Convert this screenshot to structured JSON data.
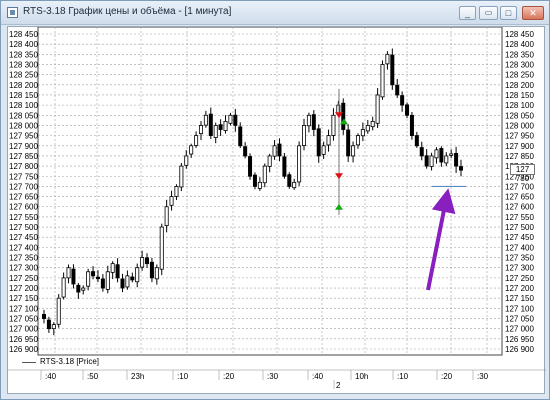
{
  "window": {
    "title": "RTS-3.18 График цены и объёма - [1 минута]",
    "buttons": {
      "minimize": "_",
      "restore": "▭",
      "close": "✕"
    }
  },
  "chart": {
    "price_badge": "127 780",
    "legend_label": "RTS-3.18 [Price]",
    "day_label": "2",
    "colors": {
      "candle": "#000000",
      "grid": "#a0a0a0",
      "marker_red": "#dd1111",
      "marker_green": "#11aa11",
      "level_line": "#4a7fc0",
      "arrow": "#8a1fbf"
    }
  },
  "chart_data": {
    "type": "candlestick",
    "y_ticks": [
      "128 450",
      "128 400",
      "128 350",
      "128 300",
      "128 250",
      "128 200",
      "128 150",
      "128 100",
      "128 050",
      "128 000",
      "127 950",
      "127 900",
      "127 850",
      "127 800",
      "127 750",
      "127 700",
      "127 650",
      "127 600",
      "127 550",
      "127 500",
      "127 450",
      "127 400",
      "127 350",
      "127 300",
      "127 250",
      "127 200",
      "127 150",
      "127 100",
      "127 050",
      "127 000",
      "126 950",
      "126 900"
    ],
    "ylim": [
      126900,
      128450
    ],
    "x_ticks": [
      ":40",
      ":50",
      "23h",
      ":10",
      ":20",
      ":30",
      ":40",
      "10h",
      ":10",
      ":20",
      ":30"
    ],
    "close_path": [
      127050,
      127000,
      127020,
      127150,
      127250,
      127300,
      127220,
      127180,
      127200,
      127280,
      127260,
      127250,
      127200,
      127280,
      127320,
      127250,
      127200,
      127260,
      127240,
      127300,
      127350,
      127320,
      127250,
      127300,
      127500,
      127600,
      127650,
      127700,
      127800,
      127850,
      127900,
      127950,
      128000,
      128050,
      127950,
      128000,
      127980,
      128020,
      128050,
      128000,
      127900,
      127850,
      127750,
      127700,
      127720,
      127800,
      127850,
      127900,
      127850,
      127750,
      127700,
      127720,
      127900,
      128000,
      128050,
      127980,
      127850,
      127900,
      127950,
      128050,
      128100,
      127980,
      127850,
      127900,
      127950,
      127980,
      128000,
      128020,
      128150,
      128300,
      128350,
      128200,
      128150,
      128100,
      128050,
      127950,
      127900,
      127850,
      127800,
      127850,
      127880,
      127820,
      127850,
      127860,
      127800,
      127780
    ],
    "annotations": [
      {
        "type": "sell_marker",
        "price": 128050
      },
      {
        "type": "sell_marker",
        "price": 127750
      },
      {
        "type": "buy_marker",
        "price": 128020
      },
      {
        "type": "buy_marker",
        "price": 127600
      },
      {
        "type": "level_line",
        "price": 127700
      }
    ]
  }
}
